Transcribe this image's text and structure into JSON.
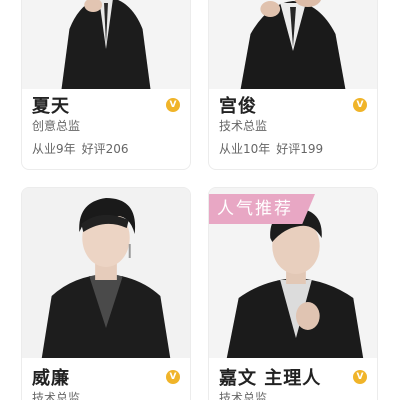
{
  "badges": {
    "popular": "人气推荐",
    "verified": "V"
  },
  "colors": {
    "verified": "#f0b429",
    "popular": "#e8a7c4",
    "text_primary": "#222222",
    "text_secondary": "#666666"
  },
  "designers": [
    {
      "name": "夏天",
      "title": "创意总监",
      "experience": "从业9年",
      "reviews": "好评206"
    },
    {
      "name": "宫俊",
      "title": "技术总监",
      "experience": "从业10年",
      "reviews": "好评199"
    },
    {
      "name": "威廉",
      "title": "技术总监"
    },
    {
      "name": "嘉文 主理人",
      "title": "技术总监",
      "badge": "人气推荐"
    }
  ]
}
